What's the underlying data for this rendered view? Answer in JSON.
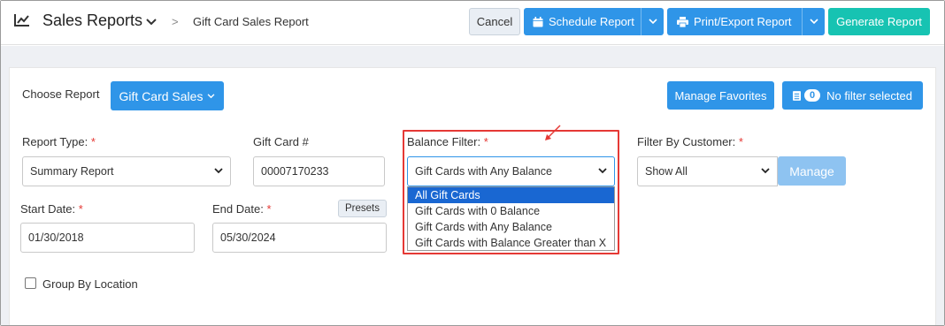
{
  "header": {
    "title": "Sales Reports",
    "breadcrumb_sep": ">",
    "breadcrumb": "Gift Card Sales Report",
    "cancel": "Cancel",
    "schedule": "Schedule Report",
    "print_export": "Print/Export Report",
    "generate": "Generate Report"
  },
  "toolbar": {
    "choose_report_label": "Choose Report",
    "report_button": "Gift Card Sales",
    "manage_favorites": "Manage Favorites",
    "filter_count": "0",
    "filter_status": "No filter selected"
  },
  "form": {
    "report_type": {
      "label": "Report Type:",
      "value": "Summary Report"
    },
    "gift_card": {
      "label": "Gift Card #",
      "value": "00007170233"
    },
    "balance_filter": {
      "label": "Balance Filter:",
      "value": "Gift Cards with Any Balance",
      "options": [
        "All Gift Cards",
        "Gift Cards with 0 Balance",
        "Gift Cards with Any Balance",
        "Gift Cards with Balance Greater than X"
      ],
      "highlighted_option": 0
    },
    "filter_by_customer": {
      "label": "Filter By Customer:",
      "value": "Show All",
      "manage": "Manage"
    },
    "start_date": {
      "label": "Start Date:",
      "value": "01/30/2018"
    },
    "end_date": {
      "label": "End Date:",
      "value": "05/30/2024",
      "presets": "Presets"
    },
    "group_by_location": {
      "label": "Group By Location",
      "checked": false
    }
  },
  "required_marker": "*",
  "colors": {
    "primary": "#2f95e8",
    "teal": "#17c3b2",
    "highlight": "#e53935",
    "manage_disabled": "#8ec3f1"
  }
}
